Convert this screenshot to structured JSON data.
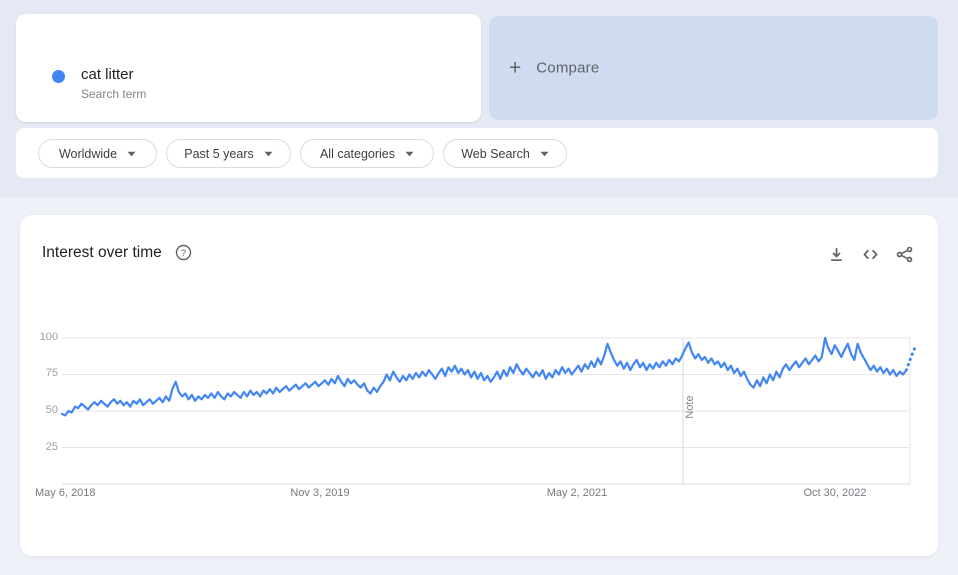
{
  "page": {
    "bg_top": "#e4e9f4",
    "bg_bottom": "#eef1f8",
    "accent": "#4285f4"
  },
  "term_card": {
    "term": "cat litter",
    "subtitle": "Search term",
    "dot_color": "#4285f4"
  },
  "compare_card": {
    "plus": "+",
    "label": "Compare",
    "bg": "#cedbf0"
  },
  "filters": {
    "geo": {
      "label": "Worldwide"
    },
    "time": {
      "label": "Past 5 years"
    },
    "category": {
      "label": "All categories"
    },
    "property": {
      "label": "Web Search"
    }
  },
  "chart_card": {
    "title": "Interest over time",
    "note_label": "Note",
    "icons": [
      "download-icon",
      "embed-icon",
      "share-icon",
      "help-icon"
    ]
  },
  "chart_data": {
    "type": "line",
    "title": "Interest over time",
    "series_name": "cat litter",
    "line_color": "#4285f4",
    "ylim": [
      0,
      100
    ],
    "yticks": [
      "100",
      "75",
      "50",
      "25"
    ],
    "xticks": [
      "May 6, 2018",
      "Nov 3, 2019",
      "May 2, 2021",
      "Oct 30, 2022"
    ],
    "x_range": [
      "May 6, 2018",
      "Apr 2023"
    ],
    "grid": "horizontal",
    "note_marker_position": "Jan 2022",
    "legend_position": "none",
    "values": [
      48,
      47,
      50,
      49,
      53,
      52,
      55,
      53,
      51,
      54,
      56,
      54,
      57,
      55,
      53,
      56,
      58,
      55,
      57,
      54,
      56,
      53,
      57,
      55,
      58,
      54,
      56,
      58,
      55,
      57,
      59,
      56,
      60,
      57,
      65,
      70,
      63,
      60,
      62,
      58,
      61,
      57,
      60,
      58,
      61,
      59,
      62,
      59,
      63,
      60,
      58,
      62,
      60,
      63,
      61,
      59,
      63,
      60,
      64,
      61,
      63,
      60,
      64,
      62,
      65,
      62,
      66,
      63,
      65,
      67,
      64,
      66,
      68,
      65,
      67,
      69,
      66,
      68,
      70,
      67,
      69,
      71,
      68,
      72,
      69,
      74,
      70,
      67,
      72,
      69,
      71,
      68,
      66,
      69,
      64,
      62,
      66,
      63,
      67,
      70,
      75,
      71,
      77,
      73,
      70,
      74,
      71,
      75,
      72,
      76,
      73,
      77,
      74,
      78,
      75,
      72,
      76,
      79,
      74,
      80,
      77,
      81,
      76,
      79,
      75,
      78,
      73,
      77,
      72,
      76,
      71,
      74,
      70,
      73,
      77,
      72,
      78,
      74,
      80,
      76,
      82,
      78,
      75,
      79,
      76,
      73,
      77,
      74,
      78,
      72,
      76,
      73,
      78,
      75,
      80,
      76,
      79,
      75,
      78,
      81,
      77,
      82,
      79,
      84,
      80,
      86,
      82,
      88,
      96,
      90,
      85,
      81,
      84,
      79,
      83,
      78,
      82,
      85,
      80,
      83,
      78,
      82,
      79,
      83,
      80,
      84,
      81,
      85,
      82,
      86,
      84,
      88,
      93,
      97,
      90,
      86,
      89,
      85,
      87,
      83,
      86,
      82,
      84,
      80,
      83,
      78,
      81,
      76,
      79,
      74,
      77,
      72,
      68,
      66,
      71,
      67,
      73,
      69,
      75,
      71,
      77,
      73,
      79,
      82,
      78,
      81,
      84,
      80,
      83,
      86,
      82,
      85,
      88,
      84,
      87,
      100,
      93,
      89,
      95,
      91,
      87,
      92,
      96,
      89,
      85,
      96,
      90,
      86,
      82,
      78,
      81,
      77,
      80,
      76,
      79,
      75,
      78,
      74,
      77,
      75,
      78
    ],
    "partial_values": [
      84,
      90,
      95
    ]
  }
}
